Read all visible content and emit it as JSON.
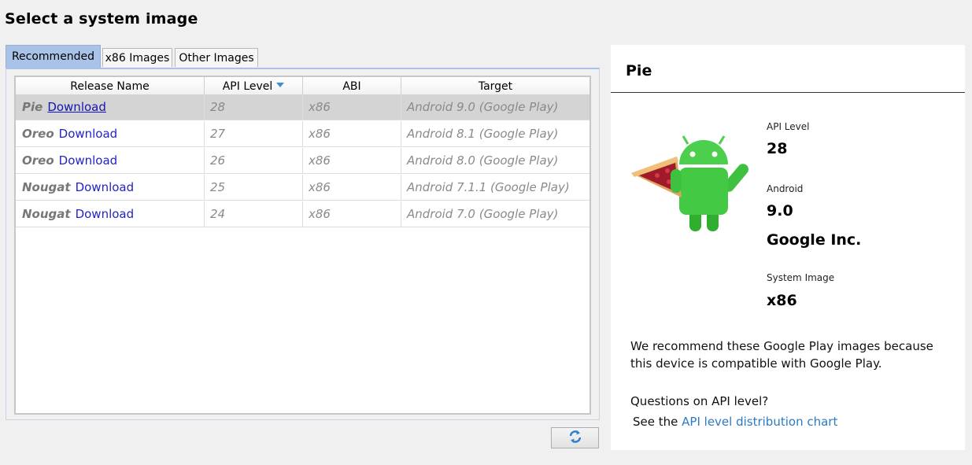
{
  "page_title": "Select a system image",
  "tabs": [
    {
      "label": "Recommended",
      "active": true
    },
    {
      "label": "x86 Images",
      "active": false
    },
    {
      "label": "Other Images",
      "active": false
    }
  ],
  "table": {
    "columns": [
      "Release Name",
      "API Level",
      "ABI",
      "Target"
    ],
    "sorted_column": "API Level",
    "rows": [
      {
        "name": "Pie",
        "action": "Download",
        "api": "28",
        "abi": "x86",
        "target": "Android 9.0 (Google Play)",
        "selected": true
      },
      {
        "name": "Oreo",
        "action": "Download",
        "api": "27",
        "abi": "x86",
        "target": "Android 8.1 (Google Play)",
        "selected": false
      },
      {
        "name": "Oreo",
        "action": "Download",
        "api": "26",
        "abi": "x86",
        "target": "Android 8.0 (Google Play)",
        "selected": false
      },
      {
        "name": "Nougat",
        "action": "Download",
        "api": "25",
        "abi": "x86",
        "target": "Android 7.1.1 (Google Play)",
        "selected": false
      },
      {
        "name": "Nougat",
        "action": "Download",
        "api": "24",
        "abi": "x86",
        "target": "Android 7.0 (Google Play)",
        "selected": false
      }
    ]
  },
  "refresh_icon": "refresh-icon",
  "detail": {
    "title": "Pie",
    "mascot_icon": "android-pie-mascot-icon",
    "api_level_label": "API Level",
    "api_level_value": "28",
    "android_label": "Android",
    "android_value": "9.0",
    "vendor": "Google Inc.",
    "system_image_label": "System Image",
    "system_image_value": "x86",
    "recommend_text": "We recommend these Google Play images because this device is compatible with Google Play.",
    "questions_text": "Questions on API level?",
    "see_the": "See the",
    "chart_link": "API level distribution chart"
  },
  "colors": {
    "active_tab": "#a9c3e8",
    "link": "#2323c8",
    "detail_link": "#2a7bc4",
    "sort_arrow": "#3c8fd0"
  }
}
